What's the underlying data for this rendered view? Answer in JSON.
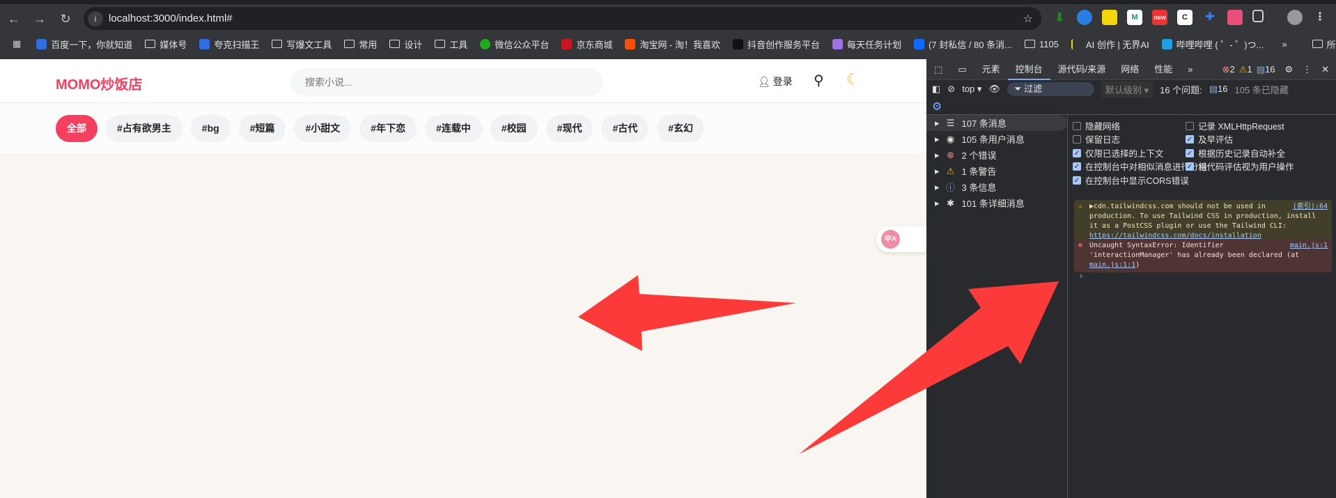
{
  "browser": {
    "url": "localhost:3000/index.html#",
    "bookmarks": [
      "百度一下，你就知道",
      "媒体号",
      "夸克扫描王",
      "写爆文工具",
      "常用",
      "设计",
      "工具",
      "微信公众平台",
      "京东商城",
      "淘宝网 - 淘！我喜欢",
      "抖音创作服务平台",
      "每天任务计划",
      "(7 封私信 / 80 条消...",
      "1105",
      "AI 创作 | 无界AI",
      "哔哩哔哩 ( ゜- ゜)つ...",
      "所有书签"
    ],
    "extension_new_badge": "new"
  },
  "page": {
    "logo": "MOMO炒饭店",
    "search_placeholder": "搜索小说...",
    "login": "登录",
    "tags": [
      "全部",
      "#占有欲男主",
      "#bg",
      "#短篇",
      "#小甜文",
      "#年下恋",
      "#连载中",
      "#校园",
      "#现代",
      "#古代",
      "#玄幻"
    ],
    "translate_icon": "中A"
  },
  "devtools": {
    "tabs": [
      "元素",
      "控制台",
      "源代码/来源",
      "网络",
      "性能"
    ],
    "errors": "2",
    "warnings": "1",
    "issues_count": "16",
    "context": "top",
    "filter": "过滤",
    "level": "默认级别",
    "issues_label": "16 个问题:",
    "issues_badge": "16",
    "hidden": "105 条已隐藏",
    "sidebar": [
      "107 条消息",
      "105 条用户消息",
      "2 个错误",
      "1 条警告",
      "3 条信息",
      "101 条详细消息"
    ],
    "settings": [
      {
        "label": "隐藏网络",
        "checked": false
      },
      {
        "label": "记录 XMLHttpRequest",
        "checked": false
      },
      {
        "label": "保留日志",
        "checked": false
      },
      {
        "label": "及早评估",
        "checked": true
      },
      {
        "label": "仅限已选择的上下文",
        "checked": true
      },
      {
        "label": "根据历史记录自动补全",
        "checked": true
      },
      {
        "label": "在控制台中对相似消息进行分组",
        "checked": true
      },
      {
        "label": "将代码评估视为用户操作",
        "checked": true
      },
      {
        "label": "在控制台中显示CORS错误",
        "checked": true
      }
    ],
    "warning": {
      "text": "▶cdn.tailwindcss.com should not be used in production. To use Tailwind CSS in production, install it as a PostCSS plugin or use the Tailwind CLI:",
      "link": "https://tailwindcss.com/docs/installation",
      "source": "(索引):64"
    },
    "error": {
      "text": "Uncaught SyntaxError: Identifier 'interactionManager' has already been declared (at",
      "link": "main.js:1:1",
      "close": ")",
      "source": "main.js:1"
    }
  },
  "colors": {
    "accent": "#f43f5e",
    "annotation": "#fc3a3a"
  }
}
